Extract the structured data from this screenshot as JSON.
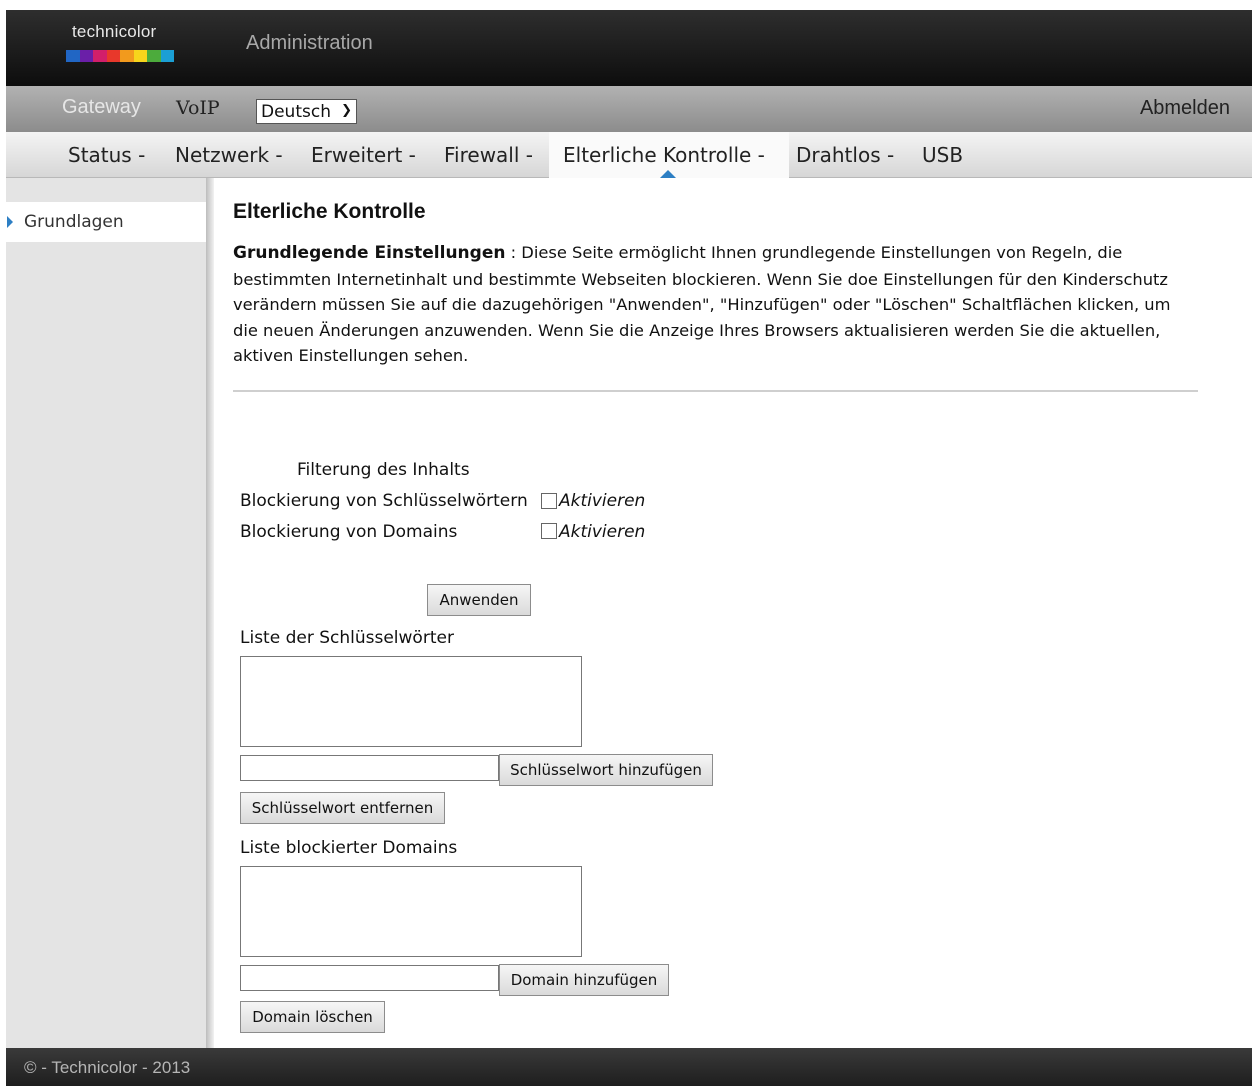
{
  "header": {
    "brand": "technicolor",
    "title": "Administration",
    "logo_colors": [
      "#2166c4",
      "#6a1fa8",
      "#d21f6a",
      "#e8382b",
      "#f29a1d",
      "#f7d51c",
      "#4cab3c",
      "#1b9fd4"
    ]
  },
  "menu": {
    "gateway": "Gateway",
    "voip": "VoIP",
    "language": "Deutsch",
    "logout": "Abmelden"
  },
  "subnav": [
    "Status -",
    "Netzwerk -",
    "Erweitert -",
    "Firewall -",
    "Elterliche Kontrolle -",
    "Drahtlos -",
    "USB"
  ],
  "sidebar": {
    "items": [
      {
        "label": "Grundlagen"
      }
    ]
  },
  "main": {
    "title": "Elterliche Kontrolle",
    "intro_bold": "Grundlegende Einstellungen",
    "intro_text": " : Diese Seite ermöglicht Ihnen grundlegende Einstellungen von Regeln, die bestimmten Internetinhalt und bestimmte Webseiten blockieren. Wenn Sie doe Einstellungen für den Kinderschutz verändern müssen Sie auf die dazugehörigen \"Anwenden\", \"Hinzufügen\" oder \"Löschen\" Schaltflächen klicken, um die neuen Änderungen anzuwenden. Wenn Sie die Anzeige Ihres Browsers aktualisieren werden Sie die aktuellen, aktiven Einstellungen sehen.",
    "filter_heading": "Filterung des Inhalts",
    "keyword_blocking_label": "Blockierung von Schlüsselwörtern",
    "domain_blocking_label": "Blockierung von Domains",
    "enable_label": "Aktivieren",
    "keyword_blocking_enabled": false,
    "domain_blocking_enabled": false,
    "apply_button": "Anwenden",
    "keyword_list_label": "Liste der Schlüsselwörter",
    "add_keyword_button": "Schlüsselwort hinzufügen",
    "remove_keyword_button": "Schlüsselwort entfernen",
    "domain_list_label": "Liste blockierter Domains",
    "add_domain_button": "Domain hinzufügen",
    "delete_domain_button": "Domain löschen"
  },
  "footer": {
    "text": "© - Technicolor - 2013"
  }
}
